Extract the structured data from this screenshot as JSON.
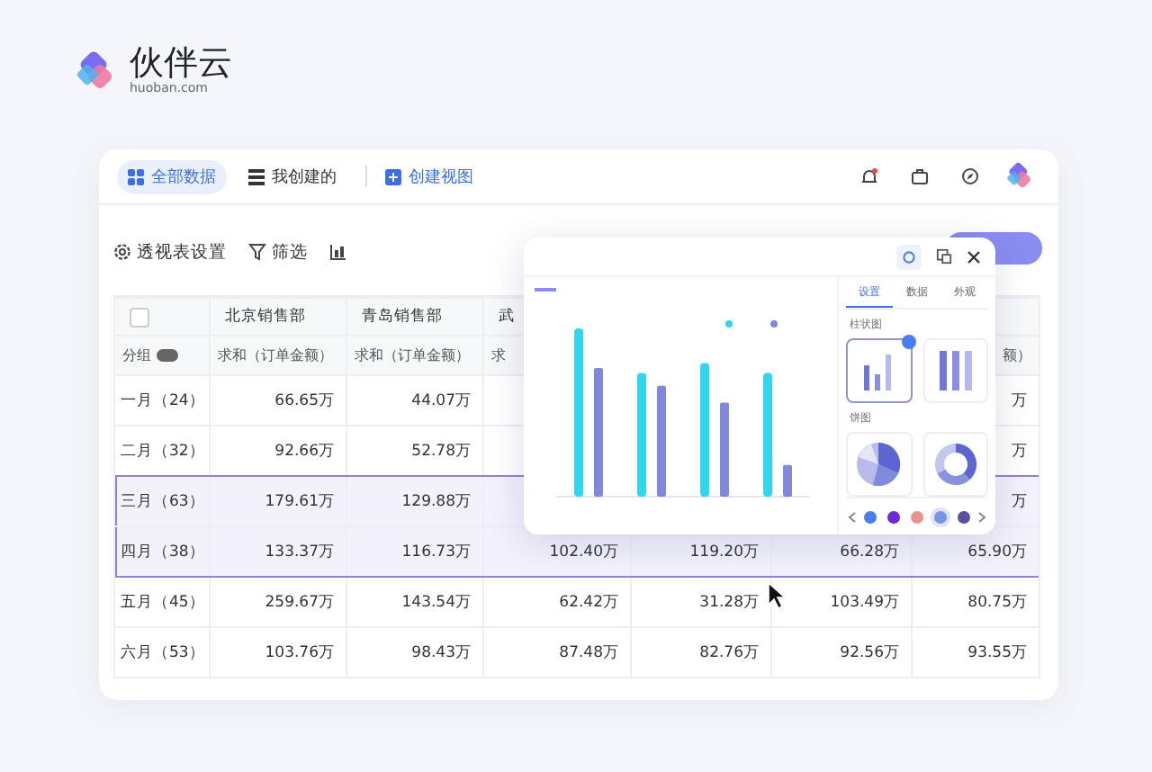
{
  "brand": {
    "name": "伙伴云",
    "domain": "huoban.com"
  },
  "view_tabs": [
    {
      "label": "全部数据",
      "selected": true
    },
    {
      "label": "我创建的",
      "selected": false
    }
  ],
  "create_view": "创建视图",
  "toolbar": [
    {
      "label": "透视表设置"
    },
    {
      "label": "筛选"
    }
  ],
  "table": {
    "select_all_checked": false,
    "headers": [
      "北京销售部",
      "青岛销售部",
      "武"
    ],
    "group_label": "分组",
    "subheaders": [
      "求和（订单金额）",
      "求和（订单金额）",
      "求"
    ],
    "last_subheader": "额）",
    "rows": [
      {
        "label": "一月（24）",
        "selected": false,
        "cells": [
          "66.65万",
          "44.07万",
          {},
          {},
          {},
          "万"
        ]
      },
      {
        "label": "二月（32）",
        "selected": false,
        "cells": [
          "92.66万",
          "52.78万",
          {},
          {},
          {},
          "万"
        ]
      },
      {
        "label": "三月（63）",
        "selected": true,
        "cells": [
          "179.61万",
          "129.88万",
          {},
          {},
          {},
          "万"
        ]
      },
      {
        "label": "四月（38）",
        "selected": true,
        "cells": [
          "133.37万",
          "116.73万",
          "102.40万",
          "119.20万",
          "66.28万",
          "65.90万"
        ]
      },
      {
        "label": "五月（45）",
        "selected": false,
        "cells": [
          "259.67万",
          "143.54万",
          "62.42万",
          "31.28万",
          "103.49万",
          "80.75万"
        ]
      },
      {
        "label": "六月（53）",
        "selected": false,
        "cells": [
          "103.76万",
          "98.43万",
          "87.48万",
          "82.76万",
          "92.56万",
          "93.55万"
        ]
      }
    ]
  },
  "chart_panel": {
    "tabs": [
      {
        "label": "设置",
        "selected": true
      },
      {
        "label": "数据",
        "selected": false
      },
      {
        "label": "外观",
        "selected": false
      }
    ],
    "sections": [
      {
        "title": "柱状图",
        "options": [
          {
            "kind": "bars",
            "selected": true
          },
          {
            "kind": "stacked",
            "selected": false
          }
        ]
      },
      {
        "title": "饼图",
        "options": [
          {
            "kind": "pie",
            "selected": false
          },
          {
            "kind": "donut",
            "selected": false
          }
        ]
      }
    ],
    "palettes": [
      {
        "color": "#4a7cf0",
        "selected": false
      },
      {
        "color": "#6a2bd8",
        "selected": false
      },
      {
        "color": "#e8948c",
        "selected": false
      },
      {
        "color": "#7b93e8",
        "selected": true
      },
      {
        "color": "#5a4fa0",
        "selected": false
      }
    ]
  }
}
